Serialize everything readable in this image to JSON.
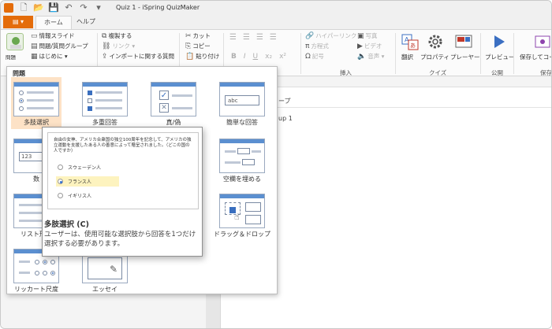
{
  "window": {
    "title": "Quiz 1 - iSpring QuizMaker"
  },
  "tabs": {
    "file": "▤ ▾",
    "home": "ホーム",
    "help": "ヘルプ"
  },
  "ribbon": {
    "question_button": "問題",
    "info_slide": "情報スライド",
    "question_group": "問題/質問グループ",
    "intro": "はじめに ▾",
    "duplicate": "複製する",
    "link": "リンク ▾",
    "import_questions": "インポートに関する質問",
    "cut": "カット",
    "copy": "コピー",
    "paste": "貼り付け",
    "bold": "B",
    "italic": "I",
    "underline": "U",
    "subscript": "x₂",
    "superscript": "x²",
    "hyperlink": "ハイパーリンク",
    "equation": "方程式",
    "symbol": "記号",
    "picture": "写真",
    "video": "ビデオ",
    "audio": "音声 ▾",
    "insert_group": "挿入",
    "translate": "翻訳",
    "properties": "プロパティ",
    "player": "プレーヤー",
    "quiz_group": "クイズ",
    "preview": "プレビュー",
    "publish_group": "公開",
    "save_as": "保存してコー",
    "save_group": "保存"
  },
  "gallery": {
    "title": "問題",
    "items": [
      {
        "label": "多肢選択"
      },
      {
        "label": "多重回答"
      },
      {
        "label": "真/偽"
      },
      {
        "label": "簡単な回答"
      },
      {
        "label": "数"
      },
      {
        "label": "空欄を埋める"
      },
      {
        "label": "リスト形式"
      },
      {
        "label": "ドラッグ＆ドロップ"
      },
      {
        "label": "リッカート尺度"
      },
      {
        "label": "エッセイ"
      }
    ]
  },
  "tooltip": {
    "question": "自由の女神、アメリカ合衆国の独立100周年を記念して、アメリカの独立運動を支援したある人の善意によって贈呈されました。（どこの国の人ですか）",
    "options": [
      "スウェーデン人",
      "フランス人",
      "イギリス人"
    ],
    "title": "多肢選択 (C)",
    "description": "ユーザーは、使用可能な選択肢から回答を1つだけ選択する必要があります。"
  },
  "right_panel": {
    "header": "ープ",
    "group_row": "up 1"
  },
  "colors": {
    "accent": "#e46c0a",
    "selected_tile": "#fde2c6",
    "highlight": "#fdf3bf"
  }
}
